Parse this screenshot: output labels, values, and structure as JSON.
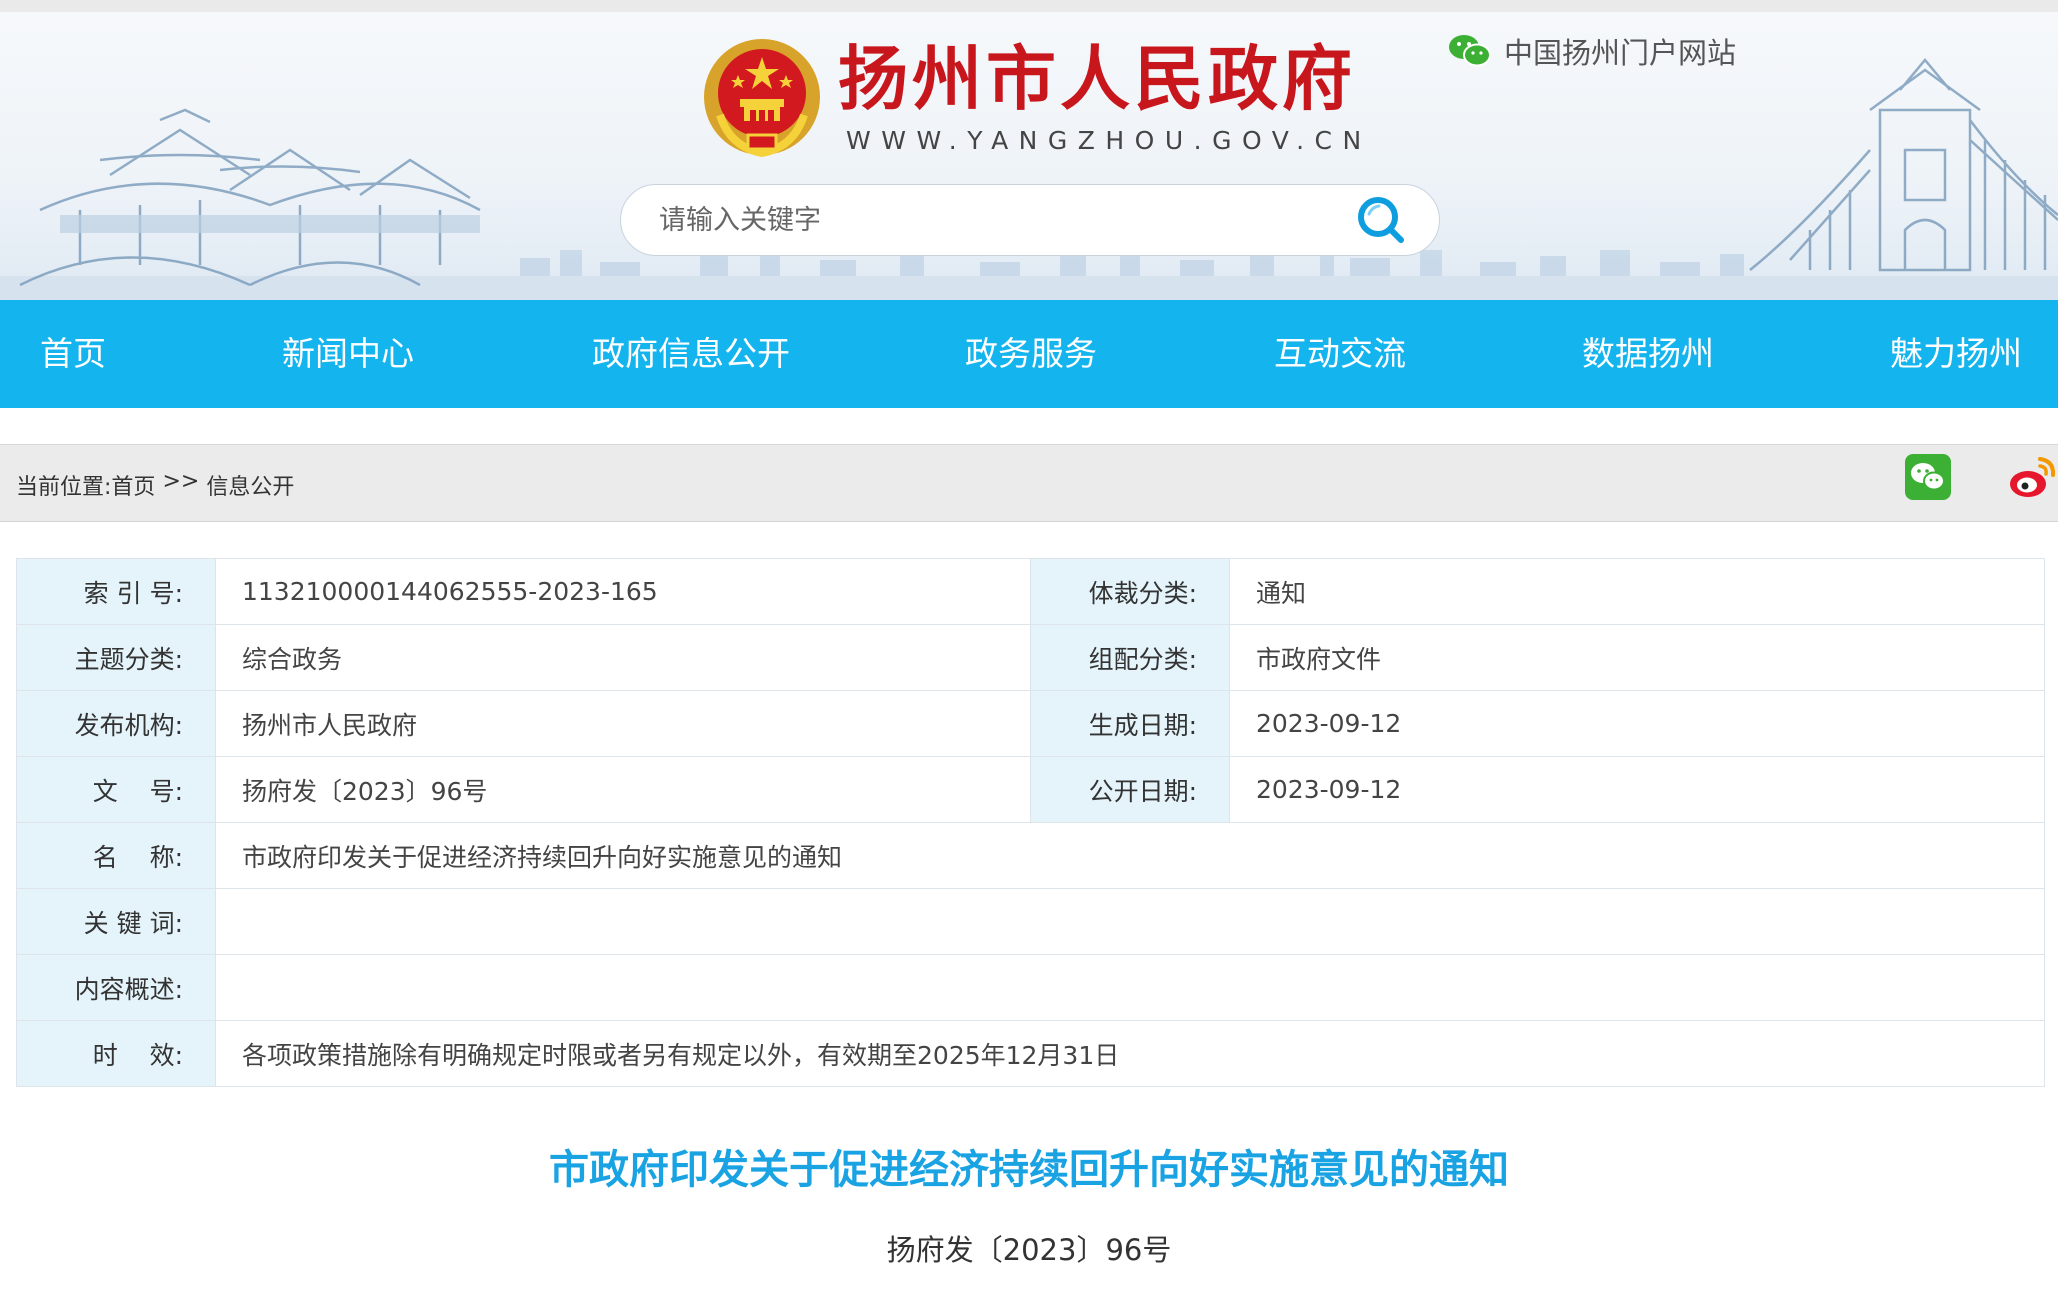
{
  "header": {
    "site_title": "扬州市人民政府",
    "site_url": "WWW.YANGZHOU.GOV.CN",
    "portal_link": "中国扬州门户网站",
    "search_placeholder": "请输入关键字"
  },
  "nav": {
    "items": [
      "首页",
      "新闻中心",
      "政府信息公开",
      "政务服务",
      "互动交流",
      "数据扬州",
      "魅力扬州"
    ]
  },
  "breadcrumb": {
    "prefix": "当前位置:",
    "home": "首页",
    "separator": ">>",
    "current": "信息公开"
  },
  "info": {
    "index_label": "索 引 号:",
    "index_value": "113210000144062555-2023-165",
    "genre_label": "体裁分类:",
    "genre_value": "通知",
    "topic_label": "主题分类:",
    "topic_value": "综合政务",
    "assign_label": "组配分类:",
    "assign_value": "市政府文件",
    "issuer_label": "发布机构:",
    "issuer_value": "扬州市人民政府",
    "created_label": "生成日期:",
    "created_value": "2023-09-12",
    "docno_label": "文    号:",
    "docno_value": "扬府发〔2023〕96号",
    "published_label": "公开日期:",
    "published_value": "2023-09-12",
    "name_label": "名    称:",
    "name_value": "市政府印发关于促进经济持续回升向好实施意见的通知",
    "keywords_label": "关 键 词:",
    "keywords_value": "",
    "summary_label": "内容概述:",
    "summary_value": "",
    "validity_label": "时    效:",
    "validity_value": "各项政策措施除有明确规定时限或者另有规定以外，有效期至2025年12月31日"
  },
  "article": {
    "title": "市政府印发关于促进经济持续回升向好实施意见的通知",
    "doc_number": "扬府发〔2023〕96号"
  },
  "colors": {
    "nav_bg": "#14b4ee",
    "title_red": "#c8161d",
    "article_title_blue": "#1aa3e3",
    "label_bg": "#e5f4fb"
  },
  "icons": [
    "national-emblem-icon",
    "wechat-icon",
    "search-icon",
    "wechat-share-icon",
    "weibo-share-icon"
  ]
}
